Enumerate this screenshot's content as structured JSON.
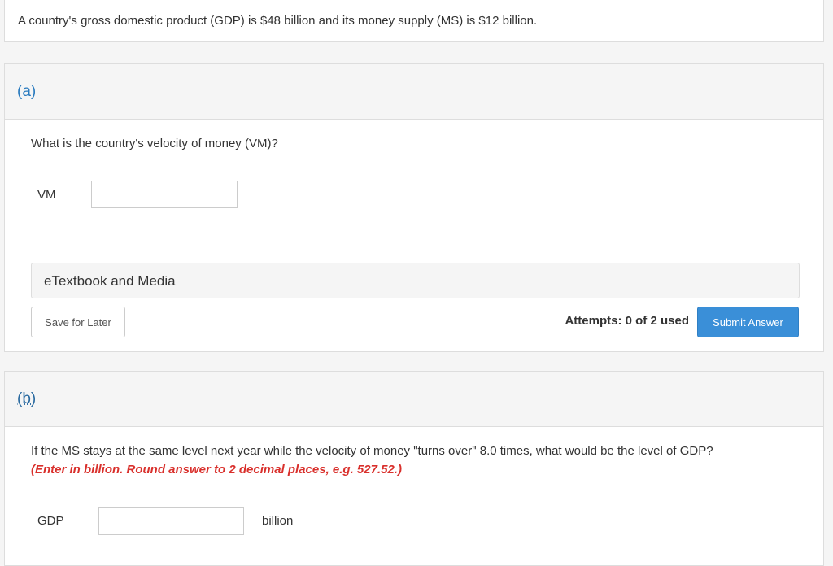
{
  "problem": {
    "stem": "A country's gross domestic product (GDP) is $48 billion and its money supply (MS) is $12 billion."
  },
  "part_a": {
    "label": "(a)",
    "question": "What is the country's velocity of money (VM)?",
    "field_label": "VM",
    "input_value": "",
    "etextbook_label": "eTextbook and Media",
    "save_label": "Save for Later",
    "attempts_label": "Attempts: 0 of 2 used",
    "submit_label": "Submit Answer"
  },
  "part_b": {
    "label": "(b)",
    "question": "If the MS stays at the same level next year while the velocity of money \"turns over\" 8.0 times, what would be the level of GDP?",
    "instruction": "(Enter in billion. Round answer to 2 decimal places, e.g. 527.52.)",
    "field_label": "GDP",
    "input_value": "",
    "unit": "billion"
  },
  "colors": {
    "accent": "#2a7bbf",
    "submit": "#3a8fd8",
    "instruction": "#d9302c"
  }
}
